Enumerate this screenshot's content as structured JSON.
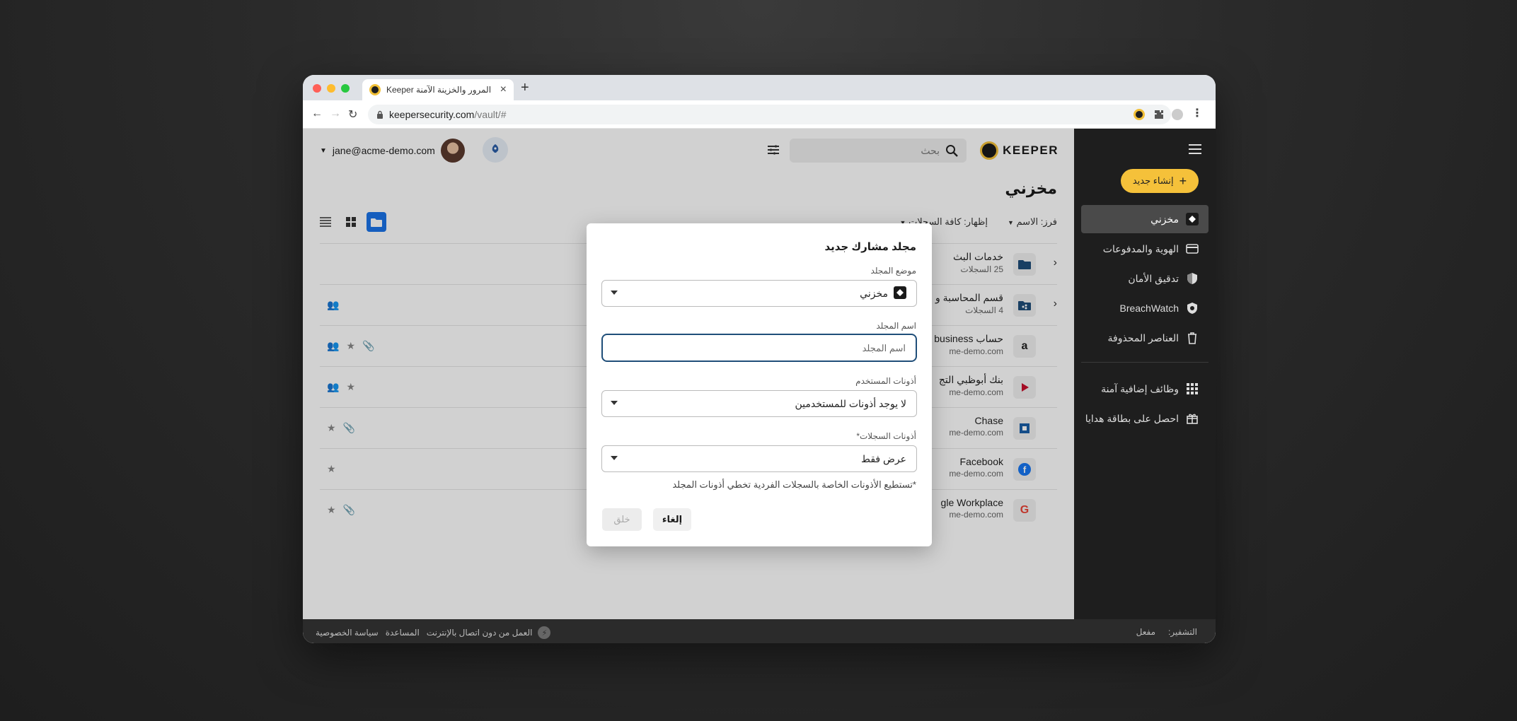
{
  "browser": {
    "tab_title": "المرور والخزينة الآمنة Keeper",
    "url_host": "keepersecurity.com",
    "url_path": "/vault/#"
  },
  "header": {
    "logo_text": "KEEPER",
    "search_placeholder": "بحث",
    "account_email": "jane@acme-demo.com"
  },
  "sidebar": {
    "create_label": "إنشاء جديد",
    "items": [
      {
        "label": "مخزني",
        "icon": "vault-icon"
      },
      {
        "label": "الهوية والمدفوعات",
        "icon": "card-icon"
      },
      {
        "label": "تدقيق الأمان",
        "icon": "shield-icon"
      },
      {
        "label": "BreachWatch",
        "icon": "breachwatch-icon"
      },
      {
        "label": "العناصر المحذوفة",
        "icon": "trash-icon"
      },
      {
        "label": "وظائف إضافية آمنة",
        "icon": "grid-icon"
      },
      {
        "label": "احصل على بطاقة هدايا",
        "icon": "gift-icon"
      }
    ]
  },
  "main": {
    "title": "مخزني",
    "sort_label": "فرز: الاسم",
    "show_label": "إظهار: كافة السجلات",
    "rows": [
      {
        "title": "خدمات البث",
        "sub": "25 السجلات"
      },
      {
        "title": "قسم المحاسبة و",
        "sub": "4 السجلات"
      },
      {
        "title": "حساب business",
        "sub": "me-demo.com"
      },
      {
        "title": "بنك أبوظبي التج",
        "sub": "me-demo.com"
      },
      {
        "title": "Chase",
        "sub": "me-demo.com"
      },
      {
        "title": "Facebook",
        "sub": "me-demo.com"
      },
      {
        "title": "gle Workplace",
        "sub": "me-demo.com"
      }
    ]
  },
  "modal": {
    "title": "مجلد مشارك جديد",
    "location_label": "موضع المجلد",
    "location_value": "مخزني",
    "name_label": "اسم المجلد",
    "name_placeholder": "اسم المجلد",
    "user_perm_label": "أذونات المستخدم",
    "user_perm_value": "لا يوجد أذونات للمستخدمين",
    "record_perm_label": "أذونات السجلات*",
    "record_perm_value": "عرض فقط",
    "note": "*تستطيع الأذونات الخاصة بالسجلات الفردية تخطي أذونات المجلد",
    "cancel_label": "إلغاء",
    "create_label": "خلق"
  },
  "footer": {
    "offline_label": "العمل من دون اتصال بالإنترنت",
    "help_label": "المساعدة",
    "privacy_label": "سياسة الخصوصية",
    "encryption_label": "التشفير:",
    "encryption_value": "مفعل"
  },
  "colors": {
    "accent_yellow": "#f5c13a",
    "sidebar_bg": "#1e1e1e",
    "focus_border": "#1f4e79",
    "view_active": "#1a73e8"
  }
}
